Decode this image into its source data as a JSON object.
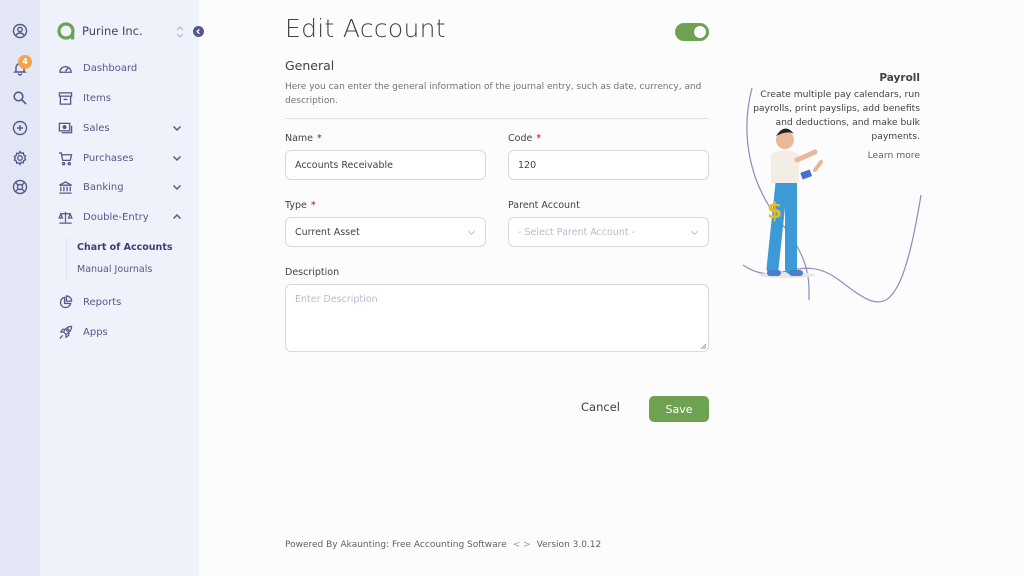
{
  "rail": {
    "icons": [
      "profile-icon",
      "bell-icon",
      "search-icon",
      "plus-circle-icon",
      "gear-icon",
      "support-icon"
    ],
    "notification_count": "4"
  },
  "sidebar": {
    "company_name": "Purine Inc.",
    "items": [
      {
        "label": "Dashboard",
        "icon": "dashboard-icon",
        "expandable": false
      },
      {
        "label": "Items",
        "icon": "archive-icon",
        "expandable": false
      },
      {
        "label": "Sales",
        "icon": "sales-icon",
        "expandable": true
      },
      {
        "label": "Purchases",
        "icon": "cart-icon",
        "expandable": true
      },
      {
        "label": "Banking",
        "icon": "bank-icon",
        "expandable": true
      },
      {
        "label": "Double-Entry",
        "icon": "scale-icon",
        "expandable": true,
        "expanded": true
      },
      {
        "label": "Reports",
        "icon": "reports-icon",
        "expandable": false
      },
      {
        "label": "Apps",
        "icon": "rocket-icon",
        "expandable": false
      }
    ],
    "sub_items": [
      {
        "label": "Chart of Accounts",
        "active": true
      },
      {
        "label": "Manual Journals",
        "active": false
      }
    ]
  },
  "page": {
    "title": "Edit Account",
    "enabled": true
  },
  "general": {
    "title": "General",
    "description": "Here you can enter the general information of the journal entry, such as date, currency, and description."
  },
  "form": {
    "name": {
      "label": "Name",
      "required_mark": "*",
      "value": "Accounts Receivable"
    },
    "code": {
      "label": "Code",
      "required_mark": "*",
      "value": "120"
    },
    "type": {
      "label": "Type",
      "required_mark": "*",
      "value": "Current Asset"
    },
    "parent": {
      "label": "Parent Account",
      "placeholder": "- Select Parent Account -"
    },
    "description": {
      "label": "Description",
      "placeholder": "Enter Description",
      "value": ""
    }
  },
  "actions": {
    "cancel_label": "Cancel",
    "save_label": "Save"
  },
  "promo": {
    "title": "Payroll",
    "text": "Create multiple pay calendars, run payrolls, print payslips, add benefits and deductions, and make bulk payments.",
    "link": "Learn more"
  },
  "footer": {
    "powered_by": "Powered By Akaunting: Free Accounting Software",
    "version": "Version 3.0.12"
  },
  "colors": {
    "accent_green": "#6ea152",
    "nav_purple": "#55588b",
    "badge_orange": "#f7a14b",
    "rail_bg": "#e3e6f5",
    "sidebar_bg": "#f0f2fb"
  }
}
